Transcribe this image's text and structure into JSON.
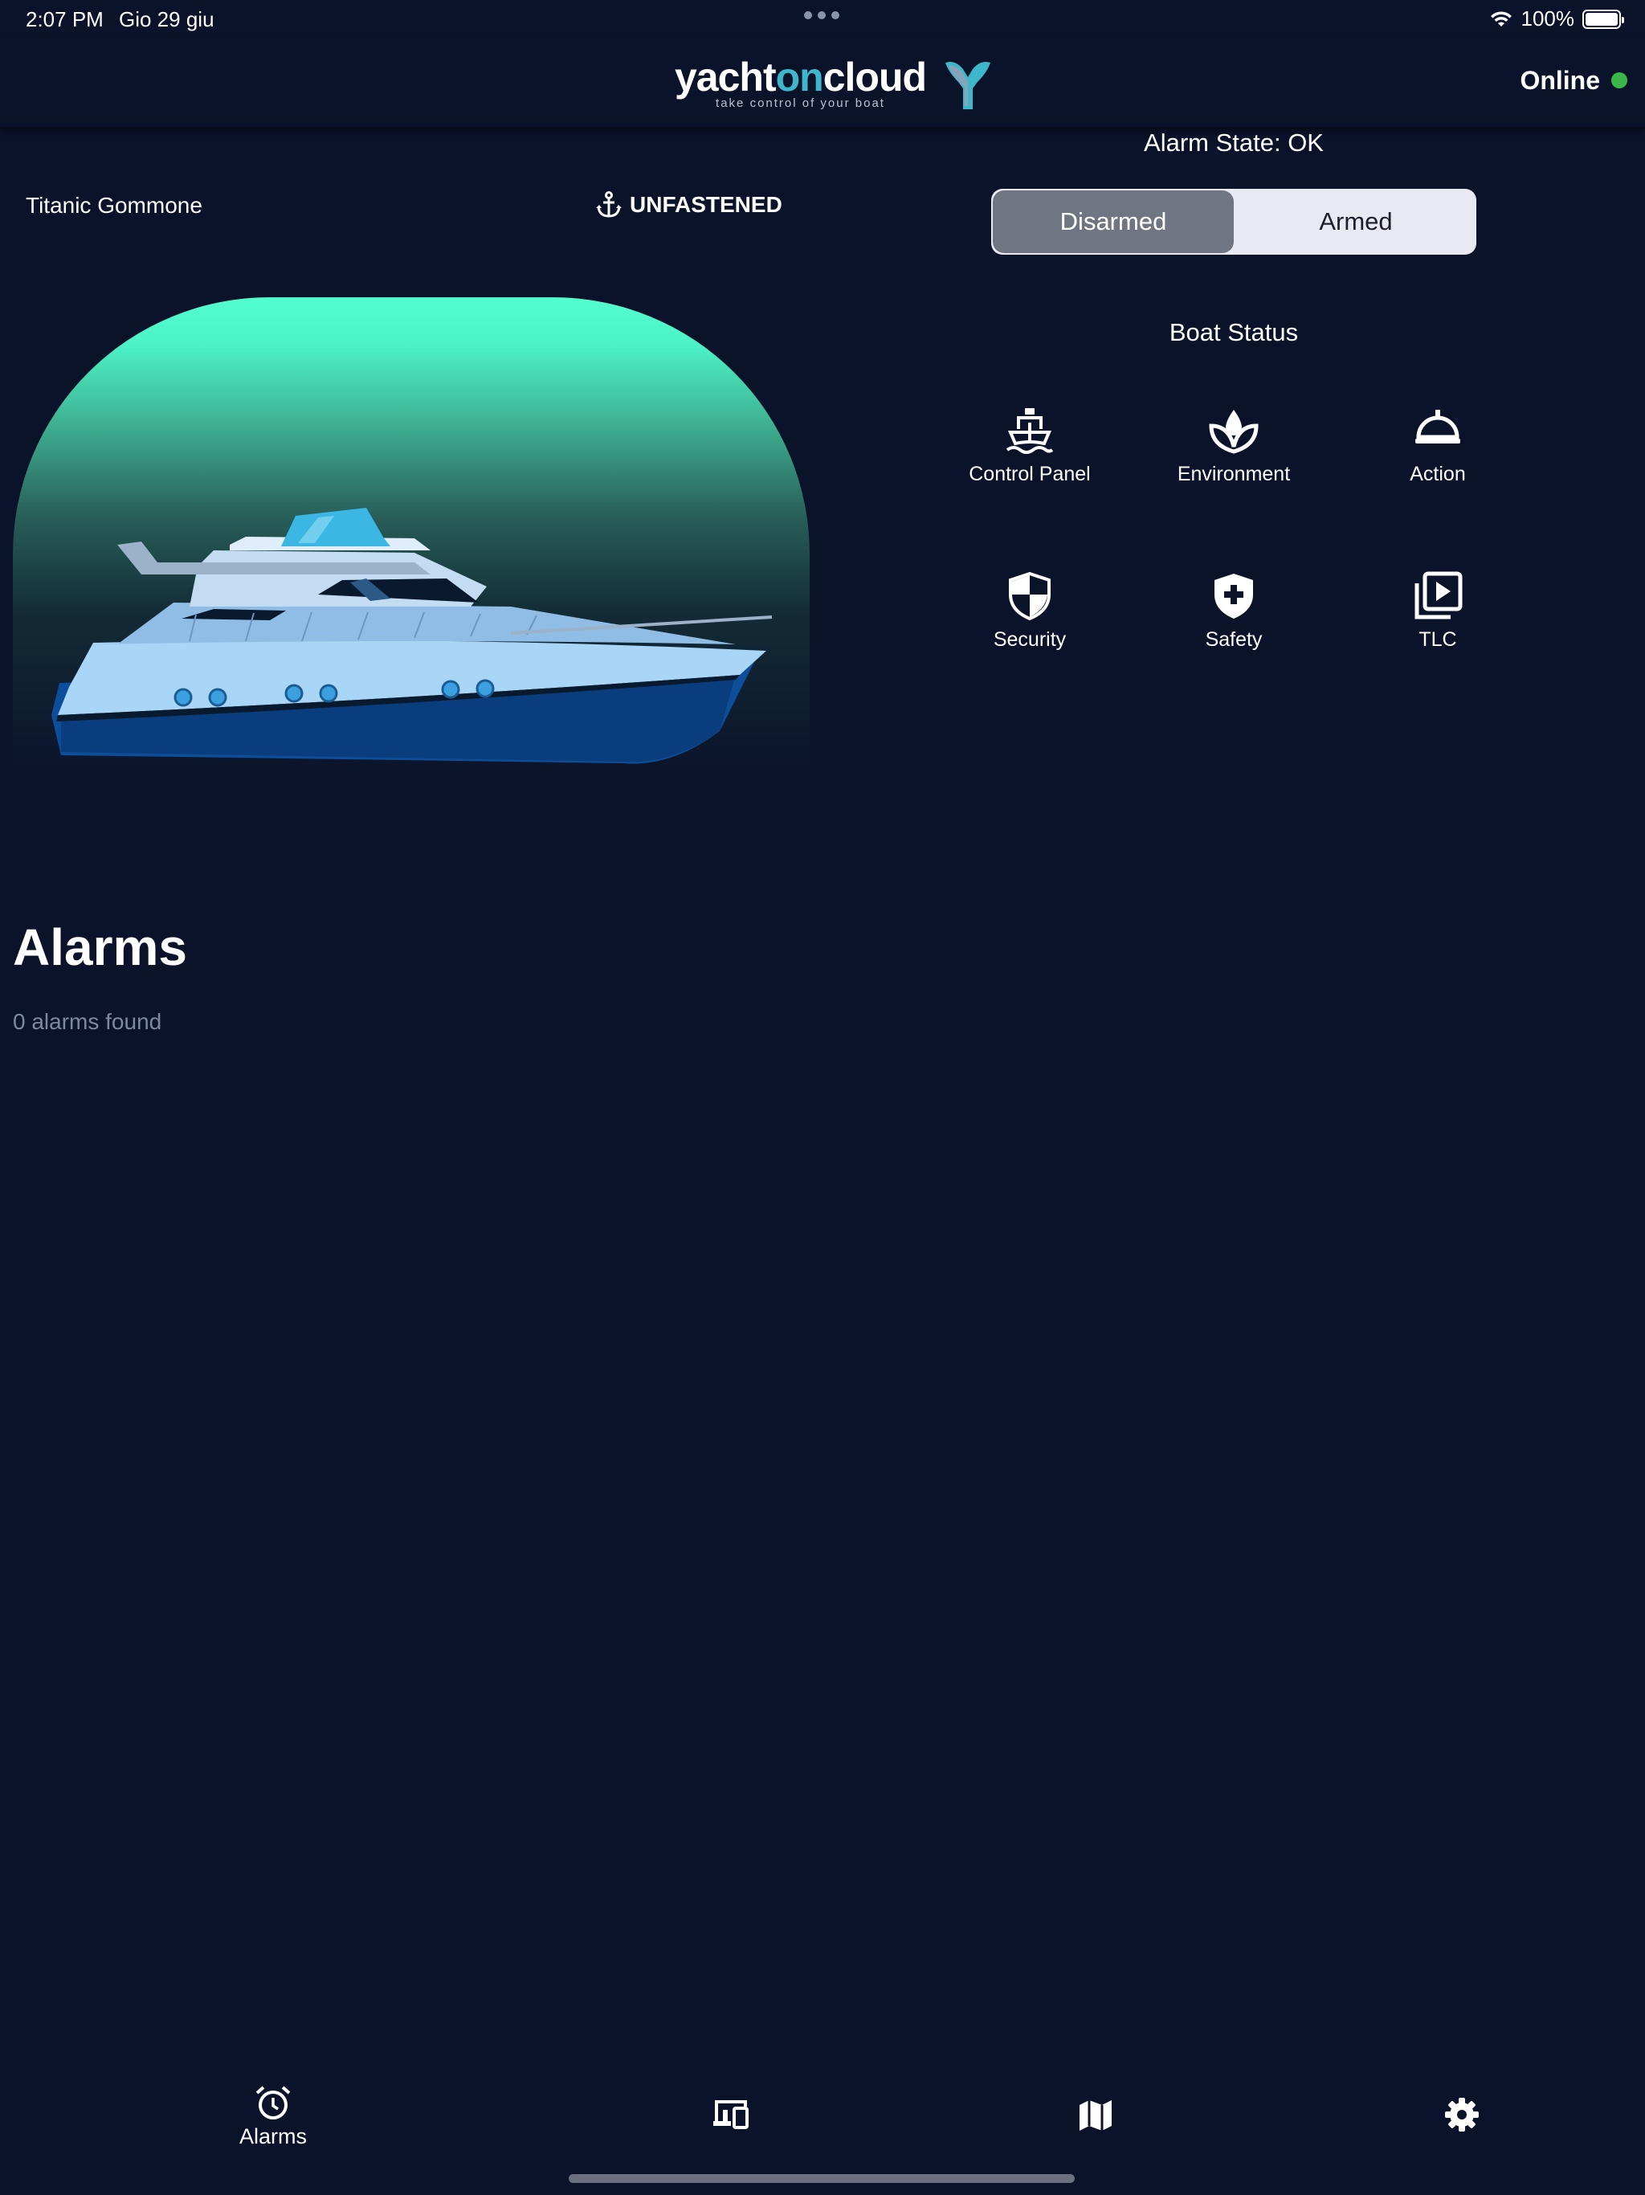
{
  "status_bar": {
    "time": "2:07 PM",
    "date": "Gio 29 giu",
    "battery": "100%"
  },
  "header": {
    "logo_word_1": "yacht",
    "logo_word_2": "on",
    "logo_word_3": "cloud",
    "logo_tagline": "take control of your boat",
    "connection_status": "Online",
    "connection_color": "#3bb54a"
  },
  "boat": {
    "name": "Titanic Gommone",
    "mooring_status": "UNFASTENED",
    "mooring_icon": "anchor-icon"
  },
  "alarm": {
    "state_label": "Alarm State: OK",
    "modes": [
      {
        "label": "Disarmed",
        "selected": true
      },
      {
        "label": "Armed",
        "selected": false
      }
    ]
  },
  "boat_status": {
    "title": "Boat Status",
    "tiles": [
      {
        "label": "Control Panel",
        "icon": "ship-icon"
      },
      {
        "label": "Environment",
        "icon": "leaf-drop-icon"
      },
      {
        "label": "Action",
        "icon": "bell-icon"
      },
      {
        "label": "Security",
        "icon": "shield-half-icon"
      },
      {
        "label": "Safety",
        "icon": "shield-plus-icon"
      },
      {
        "label": "TLC",
        "icon": "video-library-icon"
      }
    ]
  },
  "alarms": {
    "title": "Alarms",
    "count_text": "0 alarms found"
  },
  "tab_bar": {
    "tabs": [
      {
        "label": "Alarms",
        "icon": "alarm-clock-icon"
      },
      {
        "label": "",
        "icon": "devices-icon"
      },
      {
        "label": "",
        "icon": "map-icon"
      },
      {
        "label": "",
        "icon": "gear-icon"
      }
    ]
  },
  "colors": {
    "background": "#0b132b",
    "accent": "#3db7c9",
    "panel_top": "#52ffcf"
  }
}
